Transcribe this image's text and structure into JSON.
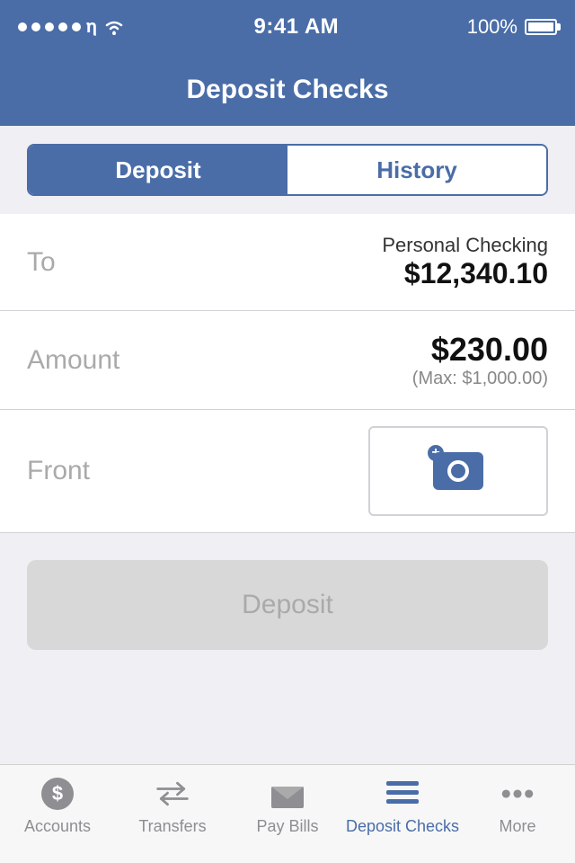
{
  "statusBar": {
    "time": "9:41 AM",
    "battery": "100%"
  },
  "navBar": {
    "title": "Deposit Checks"
  },
  "segmentControl": {
    "depositLabel": "Deposit",
    "historyLabel": "History",
    "activeTab": "deposit"
  },
  "form": {
    "toLabel": "To",
    "accountName": "Personal Checking",
    "accountBalance": "$12,340.10",
    "amountLabel": "Amount",
    "amountValue": "$230.00",
    "amountMax": "(Max: $1,000.00)",
    "frontLabel": "Front"
  },
  "depositButton": {
    "label": "Deposit"
  },
  "tabBar": {
    "accounts": "Accounts",
    "transfers": "Transfers",
    "payBills": "Pay Bills",
    "depositChecks": "Deposit Checks",
    "more": "More"
  }
}
